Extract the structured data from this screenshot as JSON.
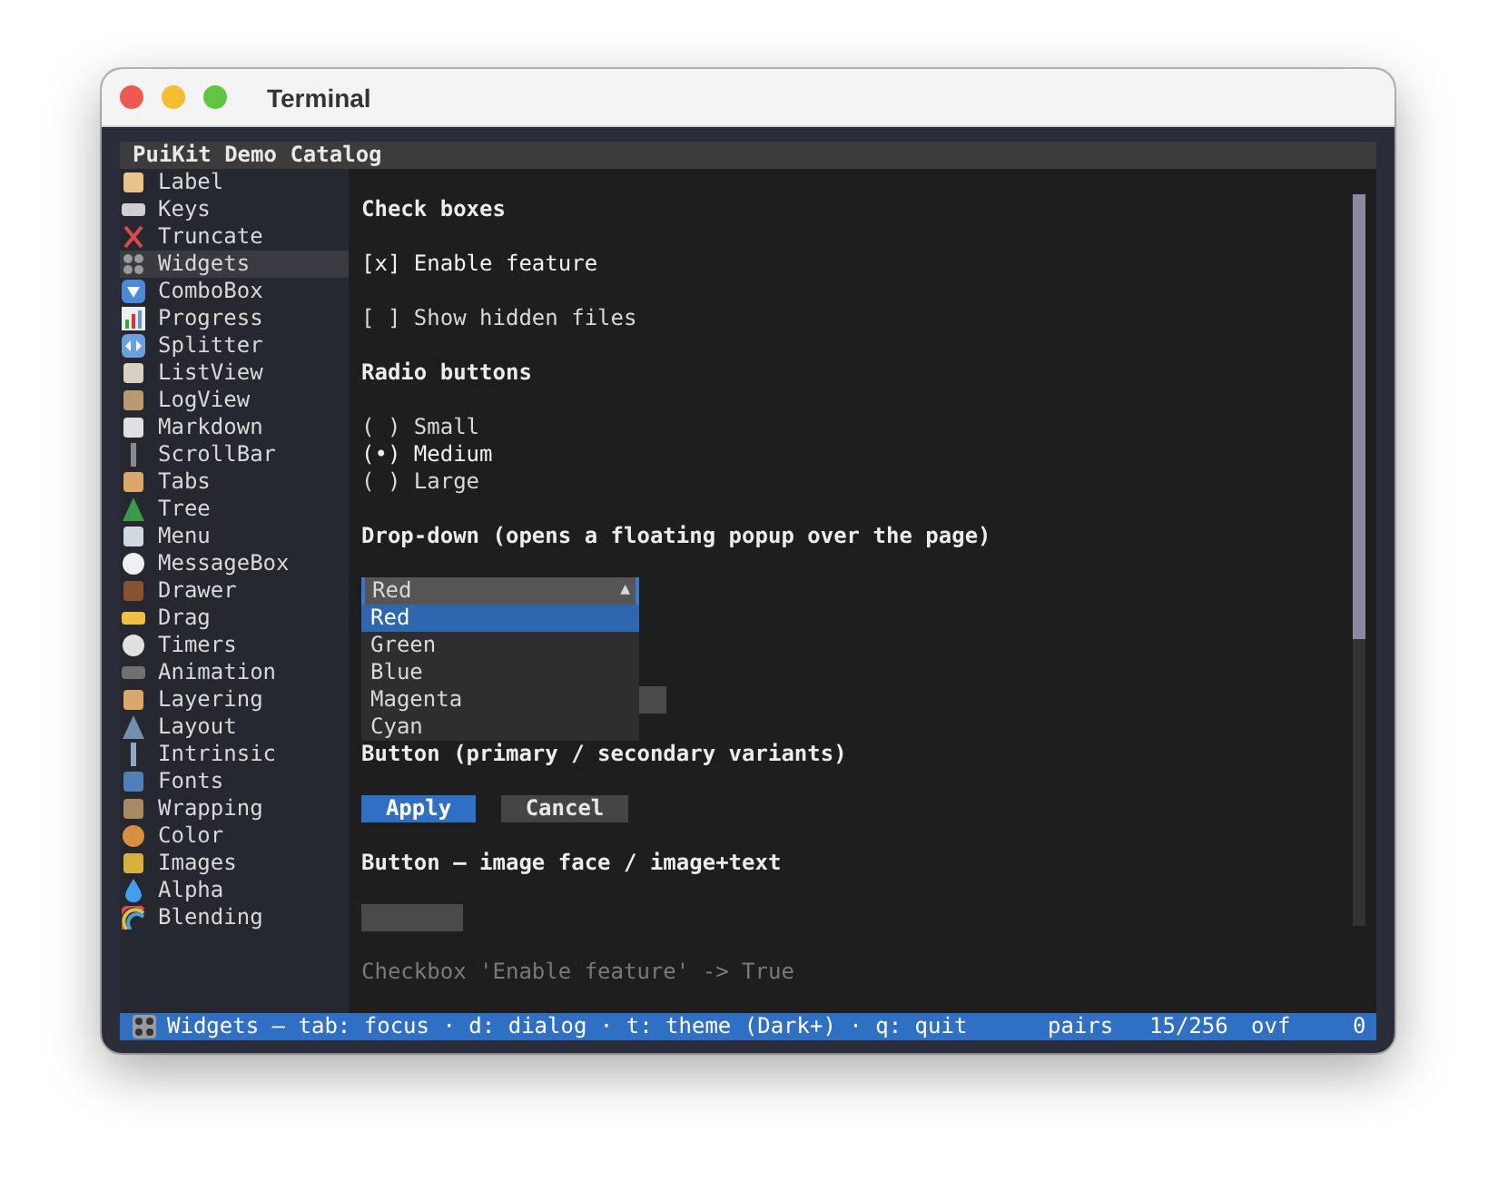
{
  "window": {
    "title": "Terminal"
  },
  "app_title": "PuiKit Demo Catalog",
  "sidebar": {
    "items": [
      {
        "label": "Label",
        "selected": false
      },
      {
        "label": "Keys",
        "selected": false
      },
      {
        "label": "Truncate",
        "selected": false
      },
      {
        "label": "Widgets",
        "selected": true
      },
      {
        "label": "ComboBox",
        "selected": false
      },
      {
        "label": "Progress",
        "selected": false
      },
      {
        "label": "Splitter",
        "selected": false
      },
      {
        "label": "ListView",
        "selected": false
      },
      {
        "label": "LogView",
        "selected": false
      },
      {
        "label": "Markdown",
        "selected": false
      },
      {
        "label": "ScrollBar",
        "selected": false
      },
      {
        "label": "Tabs",
        "selected": false
      },
      {
        "label": "Tree",
        "selected": false
      },
      {
        "label": "Menu",
        "selected": false
      },
      {
        "label": "MessageBox",
        "selected": false
      },
      {
        "label": "Drawer",
        "selected": false
      },
      {
        "label": "Drag",
        "selected": false
      },
      {
        "label": "Timers",
        "selected": false
      },
      {
        "label": "Animation",
        "selected": false
      },
      {
        "label": "Layering",
        "selected": false
      },
      {
        "label": "Layout",
        "selected": false
      },
      {
        "label": "Intrinsic",
        "selected": false
      },
      {
        "label": "Fonts",
        "selected": false
      },
      {
        "label": "Wrapping",
        "selected": false
      },
      {
        "label": "Color",
        "selected": false
      },
      {
        "label": "Images",
        "selected": false
      },
      {
        "label": "Alpha",
        "selected": false
      },
      {
        "label": "Blending",
        "selected": false
      }
    ]
  },
  "content": [
    {
      "kind": "heading",
      "text": "Check boxes"
    },
    {
      "kind": "checkbox",
      "text": "[x] Enable feature",
      "checked": true
    },
    {
      "kind": "checkbox",
      "text": "[ ] Show hidden files",
      "checked": false
    },
    {
      "kind": "heading",
      "text": "Radio buttons"
    },
    {
      "kind": "radio",
      "text": "( ) Small",
      "selected": false
    },
    {
      "kind": "radio",
      "text": "(•) Medium",
      "selected": true
    },
    {
      "kind": "radio",
      "text": "( ) Large",
      "selected": false
    },
    {
      "kind": "heading",
      "text": "Drop-down (opens a floating popup over the page)"
    },
    {
      "kind": "dropdown",
      "value": "Red",
      "arrow": "▲",
      "expanded": true,
      "options": [
        {
          "label": "Red",
          "selected": true
        },
        {
          "label": "Green",
          "selected": false
        },
        {
          "label": "Blue",
          "selected": false
        },
        {
          "label": "Magenta",
          "selected": false
        },
        {
          "label": "Cyan",
          "selected": false
        }
      ]
    },
    {
      "kind": "field"
    },
    {
      "kind": "heading",
      "text": "Button (primary / secondary variants)"
    },
    {
      "kind": "buttons",
      "buttons": [
        {
          "label": "Apply",
          "primary": true
        },
        {
          "label": "Cancel",
          "primary": false
        }
      ]
    },
    {
      "kind": "heading",
      "text": "Button — image face / image+text"
    },
    {
      "kind": "image_button"
    },
    {
      "kind": "log",
      "text": "Checkbox 'Enable feature' -> True"
    }
  ],
  "status_bar": {
    "text": "Widgets — tab: focus · d: dialog · t: theme (Dark+) · q: quit",
    "pairs": "pairs",
    "count": "15/256",
    "ovf": "ovf",
    "value": "0"
  }
}
